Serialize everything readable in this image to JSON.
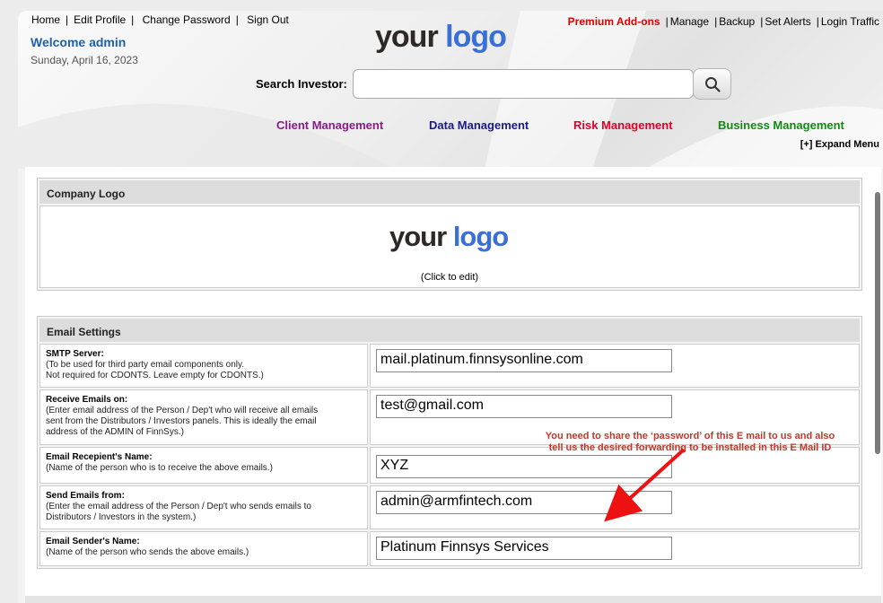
{
  "top_nav_left": [
    "Home",
    "Edit Profile",
    "Change Password",
    "Sign Out"
  ],
  "welcome": "Welcome admin",
  "date": "Sunday, April 16, 2023",
  "logo": {
    "part1": "your",
    "part2": "logo"
  },
  "top_nav_right": {
    "premium": "Premium Add-ons",
    "links": [
      "Manage",
      "Backup",
      "Set Alerts",
      "Login Traffic"
    ]
  },
  "search": {
    "label": "Search Investor:",
    "placeholder": "",
    "icon": "search-icon"
  },
  "main_menu": [
    {
      "label": "Client Management",
      "color": "#8b1a8b"
    },
    {
      "label": "Data Management",
      "color": "#1a1a8b"
    },
    {
      "label": "Risk Management",
      "color": "#e0002a"
    },
    {
      "label": "Business Management",
      "color": "#138a13"
    }
  ],
  "expand_menu": "[+] Expand Menu",
  "company_logo_panel": {
    "title": "Company Logo",
    "click_text": "(Click to edit)"
  },
  "email_settings": {
    "title": "Email Settings",
    "rows": [
      {
        "label": "SMTP Server:",
        "desc": [
          "(To be used for third party email components only.",
          "Not required for CDONTS. Leave empty for CDONTS.)"
        ],
        "value": "mail.platinum.finnsysonline.com"
      },
      {
        "label": "Receive Emails on:",
        "desc": [
          "(Enter email address of the Person / Dep't who will receive all emails",
          "sent from the Distributors / Investors panels. This is ideally the email",
          "address of the ADMIN of FinnSys.)"
        ],
        "value": "test@gmail.com"
      },
      {
        "label": "Email Recepient's Name:",
        "desc": [
          "(Name of the person who is to receive the above emails.)"
        ],
        "value": "XYZ"
      },
      {
        "label": "Send Emails from:",
        "desc": [
          "(Enter the email address of the Person / Dep't who sends emails to",
          "Distributors / Investors in the system.)"
        ],
        "value": "admin@armfintech.com"
      },
      {
        "label": "Email Sender's Name:",
        "desc": [
          "(Name of the person who sends the above emails.)"
        ],
        "value": "Platinum Finnsys Services"
      }
    ]
  },
  "annotation": {
    "line1": "You need to share the ‘password’ of this E mail to us and also",
    "line2": "tell us the desired forwarding to be installed in this E Mail ID",
    "color": "#c0392b"
  }
}
